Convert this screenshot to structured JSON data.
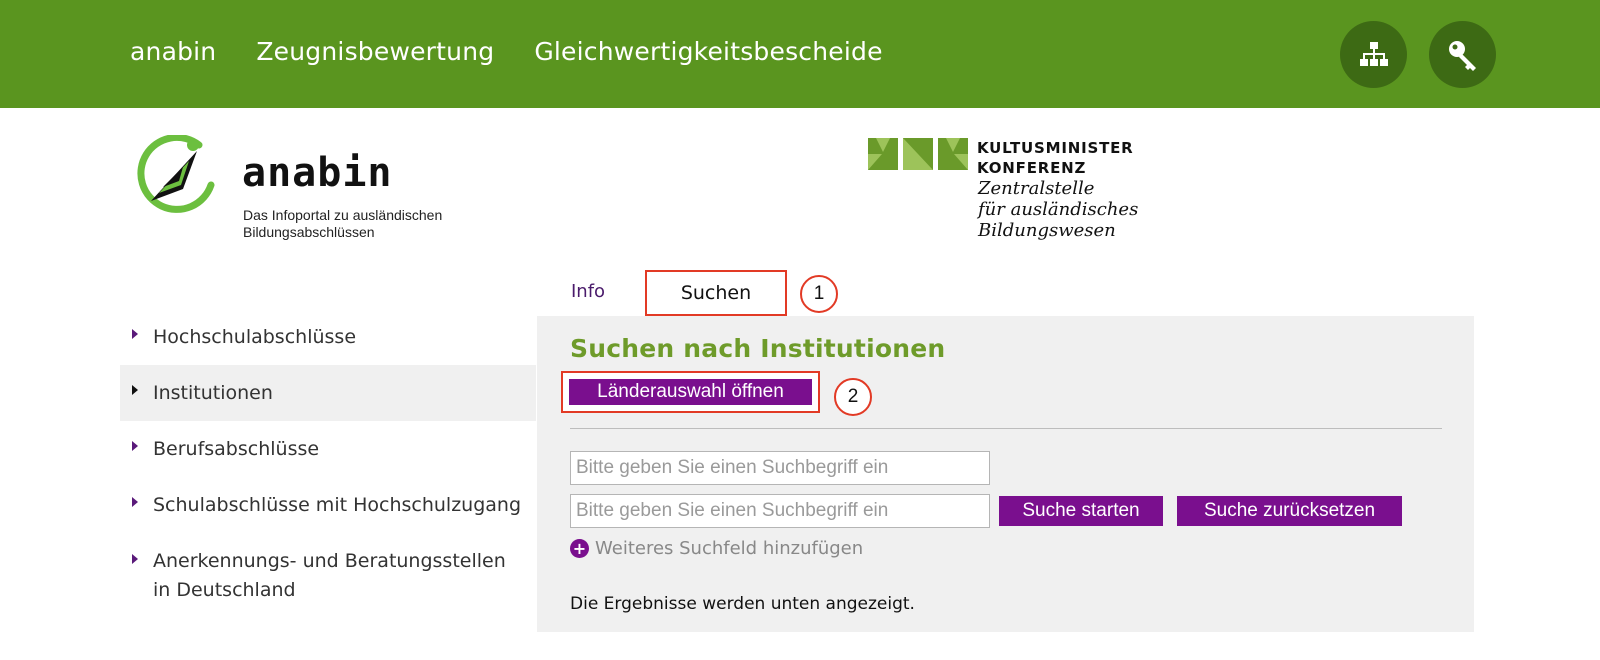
{
  "topnav": {
    "items": [
      "anabin",
      "Zeugnisbewertung",
      "Gleichwertigkeitsbescheide"
    ],
    "sitemap_icon": "sitemap-icon",
    "login_icon": "key-icon"
  },
  "logo_anabin": {
    "wordmark": "anabin",
    "tagline_line1": "Das Infoportal zu ausländischen",
    "tagline_line2": "Bildungsabschlüssen"
  },
  "logo_kmk": {
    "title_line1": "KULTUSMINISTER",
    "title_line2": "KONFERENZ",
    "sub_line1": "Zentralstelle",
    "sub_line2": "für ausländisches",
    "sub_line3": "Bildungswesen"
  },
  "tabs": {
    "info": "Info",
    "suchen": "Suchen"
  },
  "annotations": {
    "one": "1",
    "two": "2"
  },
  "sidebar": {
    "items": [
      {
        "label": "Hochschulabschlüsse"
      },
      {
        "label": "Institutionen",
        "active": true
      },
      {
        "label": "Berufsabschlüsse"
      },
      {
        "label": "Schulabschlüsse mit Hochschulzugang"
      },
      {
        "label_line1": "Anerkennungs- und Beratungsstellen",
        "label_line2": "in Deutschland"
      }
    ]
  },
  "main": {
    "title": "Suchen nach Institutionen",
    "laender_button": "Länderauswahl öffnen",
    "search_placeholder": "Bitte geben Sie einen Suchbegriff ein",
    "search_start": "Suche starten",
    "search_reset": "Suche zurücksetzen",
    "add_field": "Weiteres Suchfeld hinzufügen",
    "add_icon": "+",
    "results_note": "Die Ergebnisse werden unten angezeigt."
  },
  "colors": {
    "topbar": "#5a951f",
    "round_button": "#3d6a14",
    "accent_purple": "#7a0f8e",
    "title_green": "#6e9b2a",
    "annotation_red": "#e23a25",
    "panel_bg": "#f0f0f0"
  }
}
